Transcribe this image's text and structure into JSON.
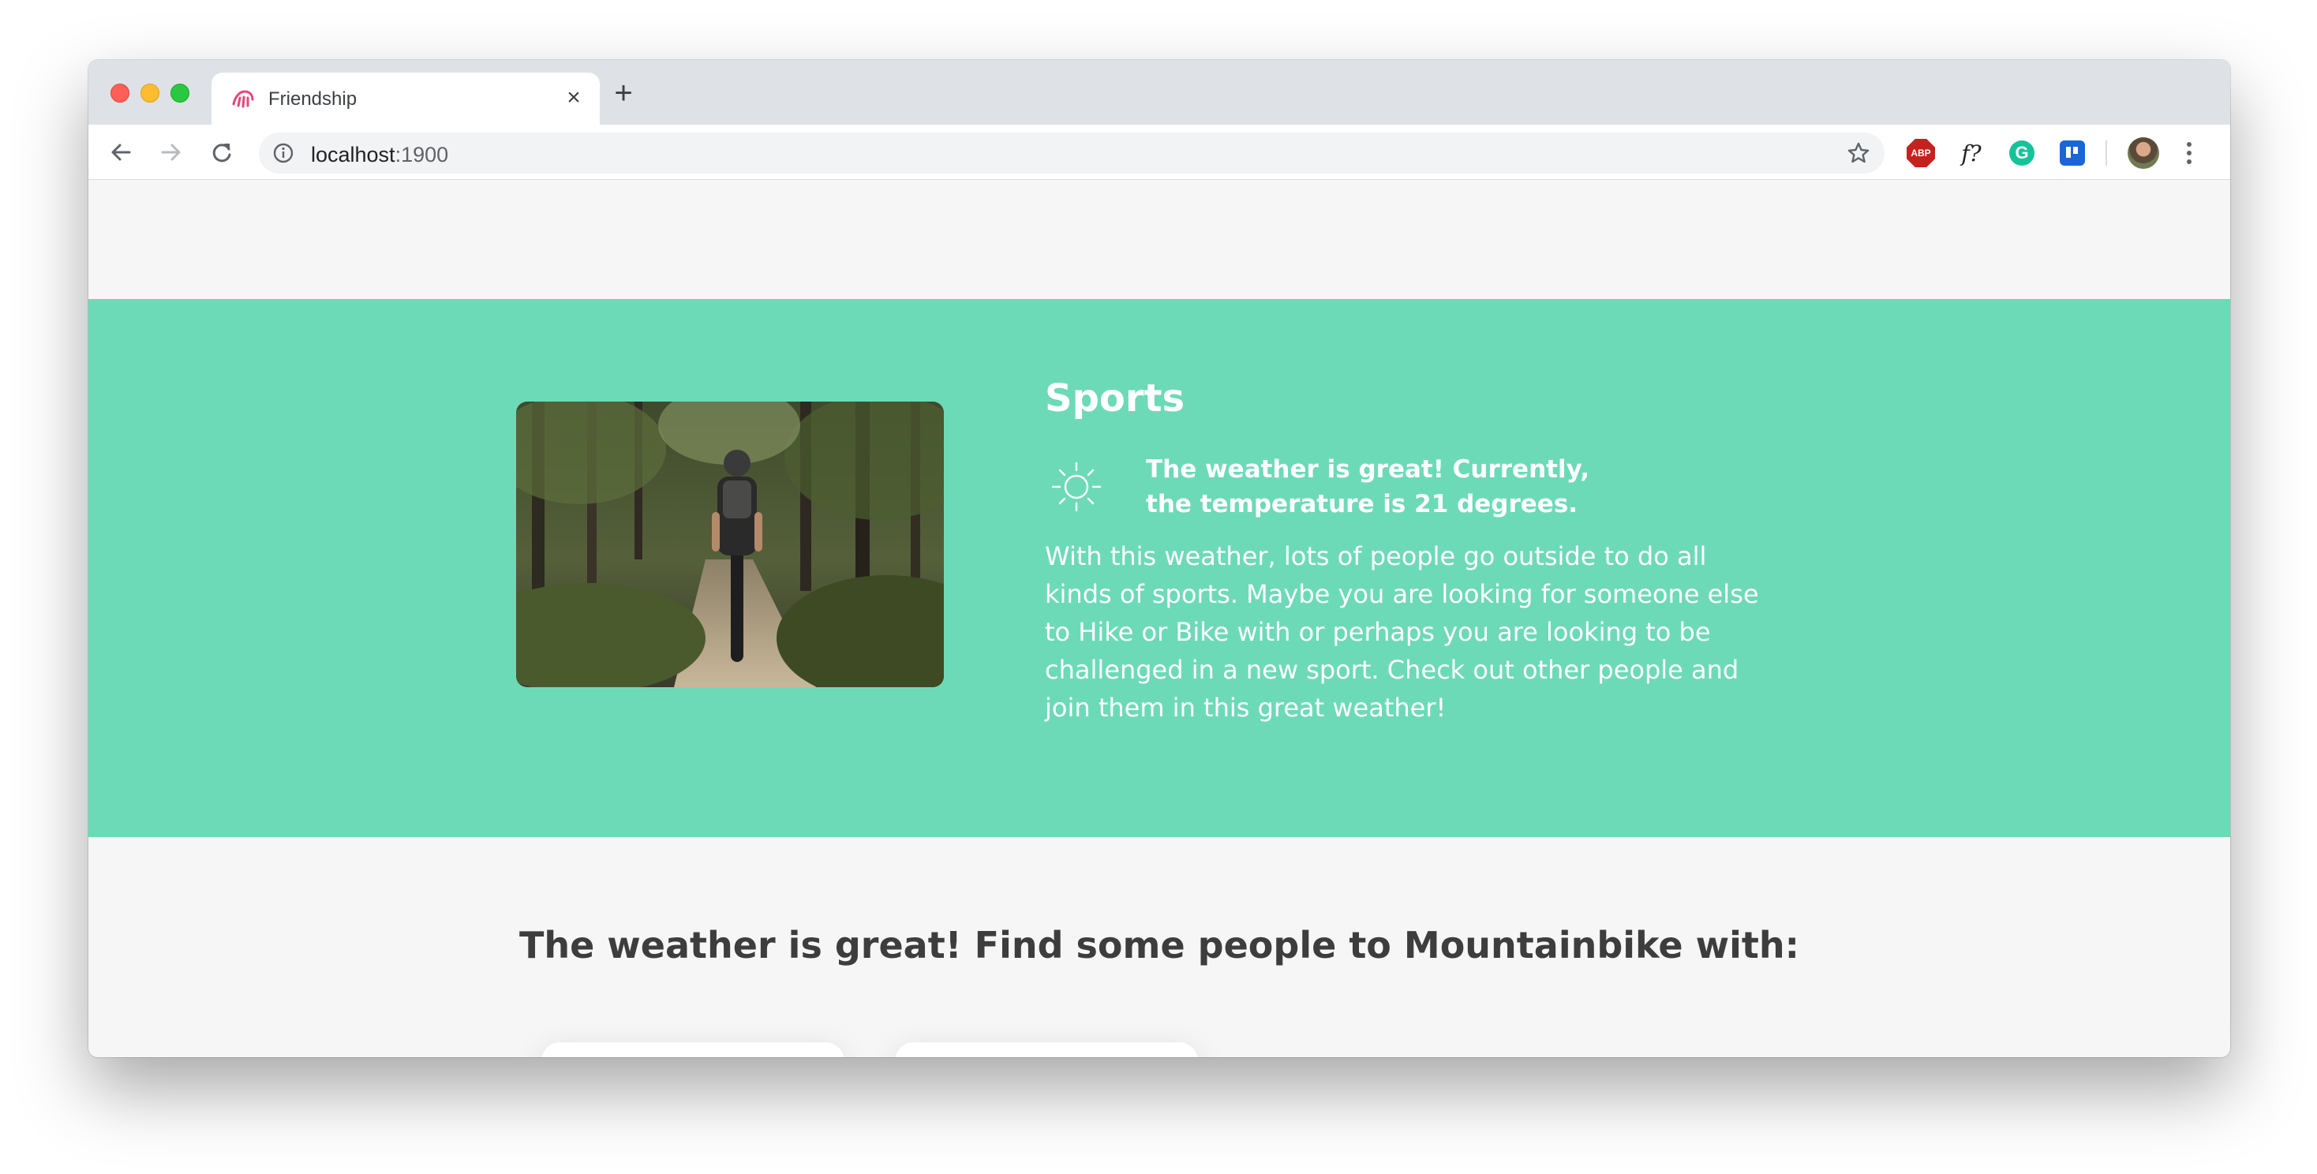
{
  "browser": {
    "tab_title": "Friendship",
    "url_host": "localhost",
    "url_port": ":1900",
    "close_symbol": "×",
    "new_tab_symbol": "+",
    "extensions": {
      "abp_label": "ABP",
      "f_label": "f?",
      "g_label": "G"
    }
  },
  "hero": {
    "heading": "Sports",
    "weather_line": "The weather is great! Currently, the temperature is 21 degrees.",
    "body": "With this weather, lots of people go outside to do all kinds of sports. Maybe you are looking for someone else to Hike or Bike with or perhaps you are looking to be challenged in a new sport. Check out other people and join them in this great weather!",
    "background_color": "#6ddab7",
    "icon": "sun-icon"
  },
  "people": {
    "heading": "The weather is great! Find some people to Mountainbike with:"
  }
}
